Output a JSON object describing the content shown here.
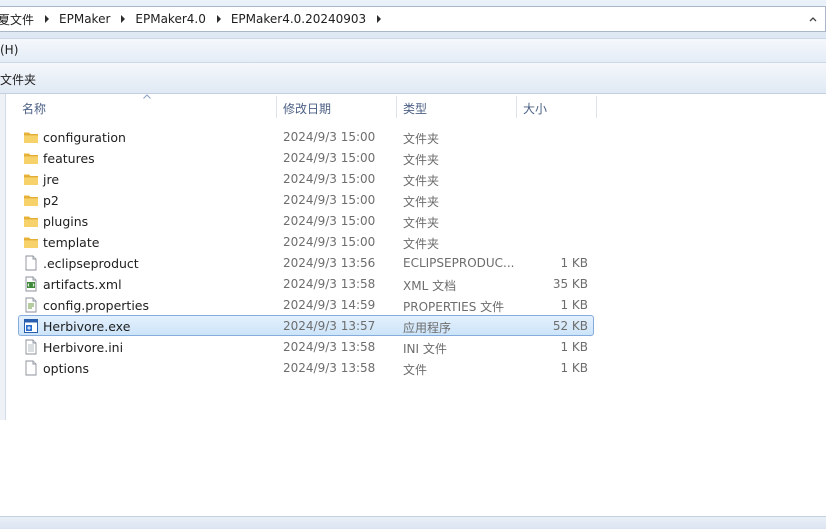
{
  "address_bar": {
    "crumbs": [
      "夏文件",
      "EPMaker",
      "EPMaker4.0",
      "EPMaker4.0.20240903"
    ]
  },
  "menu_bar": {
    "items": [
      "(H)"
    ]
  },
  "toolbar": {
    "items": [
      "文件夹"
    ]
  },
  "columns": {
    "name": "名称",
    "date": "修改日期",
    "type": "类型",
    "size": "大小"
  },
  "files": [
    {
      "name": "configuration",
      "date": "2024/9/3 15:00",
      "type": "文件夹",
      "size": "",
      "icon": "folder-icon"
    },
    {
      "name": "features",
      "date": "2024/9/3 15:00",
      "type": "文件夹",
      "size": "",
      "icon": "folder-icon"
    },
    {
      "name": "jre",
      "date": "2024/9/3 15:00",
      "type": "文件夹",
      "size": "",
      "icon": "folder-icon"
    },
    {
      "name": "p2",
      "date": "2024/9/3 15:00",
      "type": "文件夹",
      "size": "",
      "icon": "folder-icon"
    },
    {
      "name": "plugins",
      "date": "2024/9/3 15:00",
      "type": "文件夹",
      "size": "",
      "icon": "folder-icon"
    },
    {
      "name": "template",
      "date": "2024/9/3 15:00",
      "type": "文件夹",
      "size": "",
      "icon": "folder-icon"
    },
    {
      "name": ".eclipseproduct",
      "date": "2024/9/3 13:56",
      "type": "ECLIPSEPRODUC...",
      "size": "1 KB",
      "icon": "blank-file-icon"
    },
    {
      "name": "artifacts.xml",
      "date": "2024/9/3 13:58",
      "type": "XML 文档",
      "size": "35 KB",
      "icon": "xml-file-icon"
    },
    {
      "name": "config.properties",
      "date": "2024/9/3 14:59",
      "type": "PROPERTIES 文件",
      "size": "1 KB",
      "icon": "properties-file-icon"
    },
    {
      "name": "Herbivore.exe",
      "date": "2024/9/3 13:57",
      "type": "应用程序",
      "size": "52 KB",
      "icon": "exe-app-icon",
      "selected": true
    },
    {
      "name": "Herbivore.ini",
      "date": "2024/9/3 13:58",
      "type": "INI 文件",
      "size": "1 KB",
      "icon": "ini-file-icon"
    },
    {
      "name": "options",
      "date": "2024/9/3 13:58",
      "type": "文件",
      "size": "1 KB",
      "icon": "blank-file-icon"
    }
  ],
  "colors": {
    "selection_fill": "#cce4f9",
    "selection_border": "#84acdd",
    "header_text": "#4d6185",
    "folder_yellow": "#f2c14e"
  }
}
